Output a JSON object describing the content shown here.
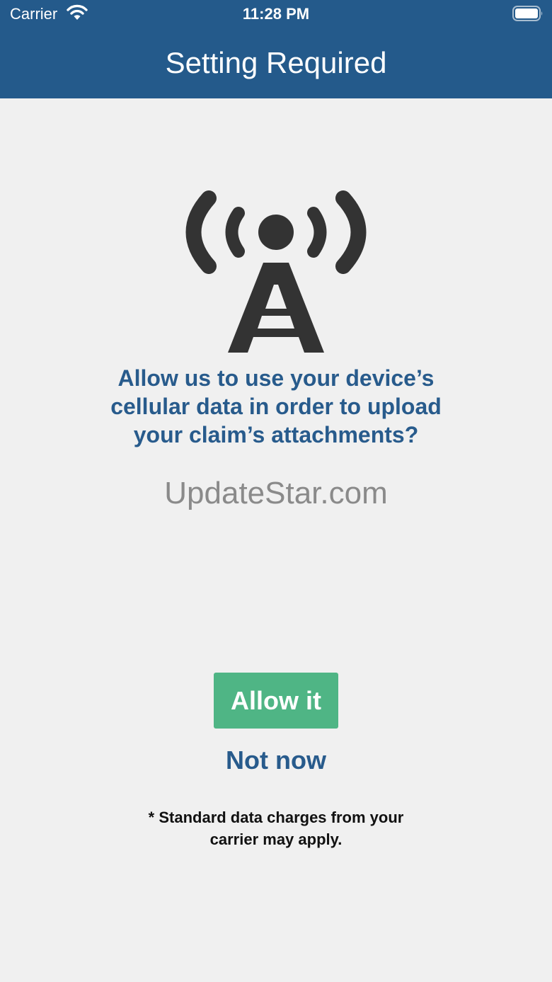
{
  "status_bar": {
    "carrier": "Carrier",
    "time": "11:28 PM",
    "wifi_icon": "wifi-icon",
    "battery_icon": "battery-icon"
  },
  "nav": {
    "title": "Setting Required"
  },
  "content": {
    "icon": "cell-tower-icon",
    "prompt": "Allow us to use your device’s cellular data in order to upload your claim’s attachments?",
    "watermark": "UpdateStar.com",
    "allow_label": "Allow it",
    "not_now_label": "Not now",
    "disclaimer": "* Standard data charges from your carrier may apply."
  },
  "colors": {
    "nav_background": "#245a8b",
    "accent_text": "#285b8c",
    "allow_button": "#4fb585",
    "page_background": "#f0f0f0",
    "icon": "#333333"
  }
}
